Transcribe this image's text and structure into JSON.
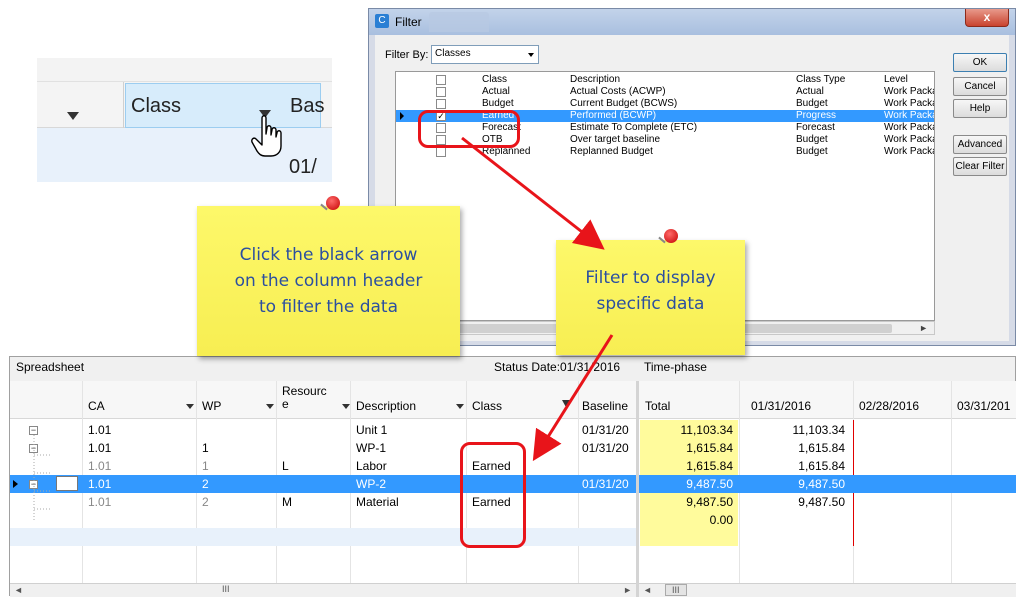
{
  "zoom": {
    "class_label": "Class",
    "baseline_fragment": "Bas",
    "date_fragment": "01/"
  },
  "filter": {
    "title": "Filter",
    "close_label": "x",
    "filter_by_label": "Filter By:",
    "filter_by_value": "Classes",
    "buttons": {
      "ok": "OK",
      "cancel": "Cancel",
      "help": "Help",
      "advanced": "Advanced",
      "clear": "Clear Filter"
    },
    "columns": {
      "class": "Class",
      "description": "Description",
      "class_type": "Class Type",
      "level": "Level"
    },
    "rows": [
      {
        "class": "Actual",
        "description": "Actual Costs (ACWP)",
        "class_type": "Actual",
        "level": "Work Packa",
        "checked": false
      },
      {
        "class": "Budget",
        "description": "Current Budget (BCWS)",
        "class_type": "Budget",
        "level": "Work Packa",
        "checked": false
      },
      {
        "class": "Earned",
        "description": "Performed (BCWP)",
        "class_type": "Progress",
        "level": "Work Packa",
        "checked": true
      },
      {
        "class": "Forecast",
        "description": "Estimate To Complete (ETC)",
        "class_type": "Forecast",
        "level": "Work Packa",
        "checked": false
      },
      {
        "class": "OTB",
        "description": "Over target baseline",
        "class_type": "Budget",
        "level": "Work Packa",
        "checked": false
      },
      {
        "class": "Replanned",
        "description": "Replanned Budget",
        "class_type": "Budget",
        "level": "Work Packa",
        "checked": false
      }
    ],
    "checkmark": "✓"
  },
  "notes": {
    "note1_line1": "Click the black arrow",
    "note1_line2": "on the column header",
    "note1_line3": "to filter the data",
    "note2_line1": "Filter to display",
    "note2_line2": "specific data"
  },
  "app": {
    "spreadsheet_title": "Spreadsheet",
    "status_date": "Status Date:01/31/2016",
    "timephase_title": "Time-phase",
    "columns": {
      "ca": "CA",
      "wp": "WP",
      "resource_1": "Resourc",
      "resource_2": "e",
      "description": "Description",
      "class": "Class",
      "baseline": "Baseline"
    },
    "rows": [
      {
        "toggle": "−",
        "ca": "1.01",
        "wp": "",
        "res": "",
        "desc": "Unit 1",
        "class": "",
        "baseline": "01/31/20"
      },
      {
        "toggle": "−",
        "ca": "1.01",
        "wp": "1",
        "res": "",
        "desc": "WP-1",
        "class": "",
        "baseline": "01/31/20"
      },
      {
        "toggle": "",
        "ca": "1.01",
        "wp": "1",
        "res": "L",
        "desc": "Labor",
        "class": "Earned",
        "baseline": ""
      },
      {
        "toggle": "−",
        "ca": "1.01",
        "wp": "2",
        "res": "",
        "desc": "WP-2",
        "class": "",
        "baseline": "01/31/20"
      },
      {
        "toggle": "",
        "ca": "1.01",
        "wp": "2",
        "res": "M",
        "desc": "Material",
        "class": "Earned",
        "baseline": ""
      }
    ],
    "tp_columns": {
      "total": "Total",
      "d1": "01/31/2016",
      "d2": "02/28/2016",
      "d3": "03/31/201"
    },
    "tp_rows": [
      {
        "total": "11,103.34",
        "d1": "11,103.34"
      },
      {
        "total": "1,615.84",
        "d1": "1,615.84"
      },
      {
        "total": "1,615.84",
        "d1": "1,615.84"
      },
      {
        "total": "9,487.50",
        "d1": "9,487.50"
      },
      {
        "total": "9,487.50",
        "d1": "9,487.50"
      },
      {
        "total": "0.00",
        "d1": ""
      }
    ],
    "scroll_thumb_label": "III"
  },
  "colors": {
    "selection": "#3399ff",
    "highlight_red": "#e8141a",
    "note_yellow": "#fdf86a",
    "note_text": "#2b4fa0",
    "total_yellow": "#fffb9c"
  }
}
